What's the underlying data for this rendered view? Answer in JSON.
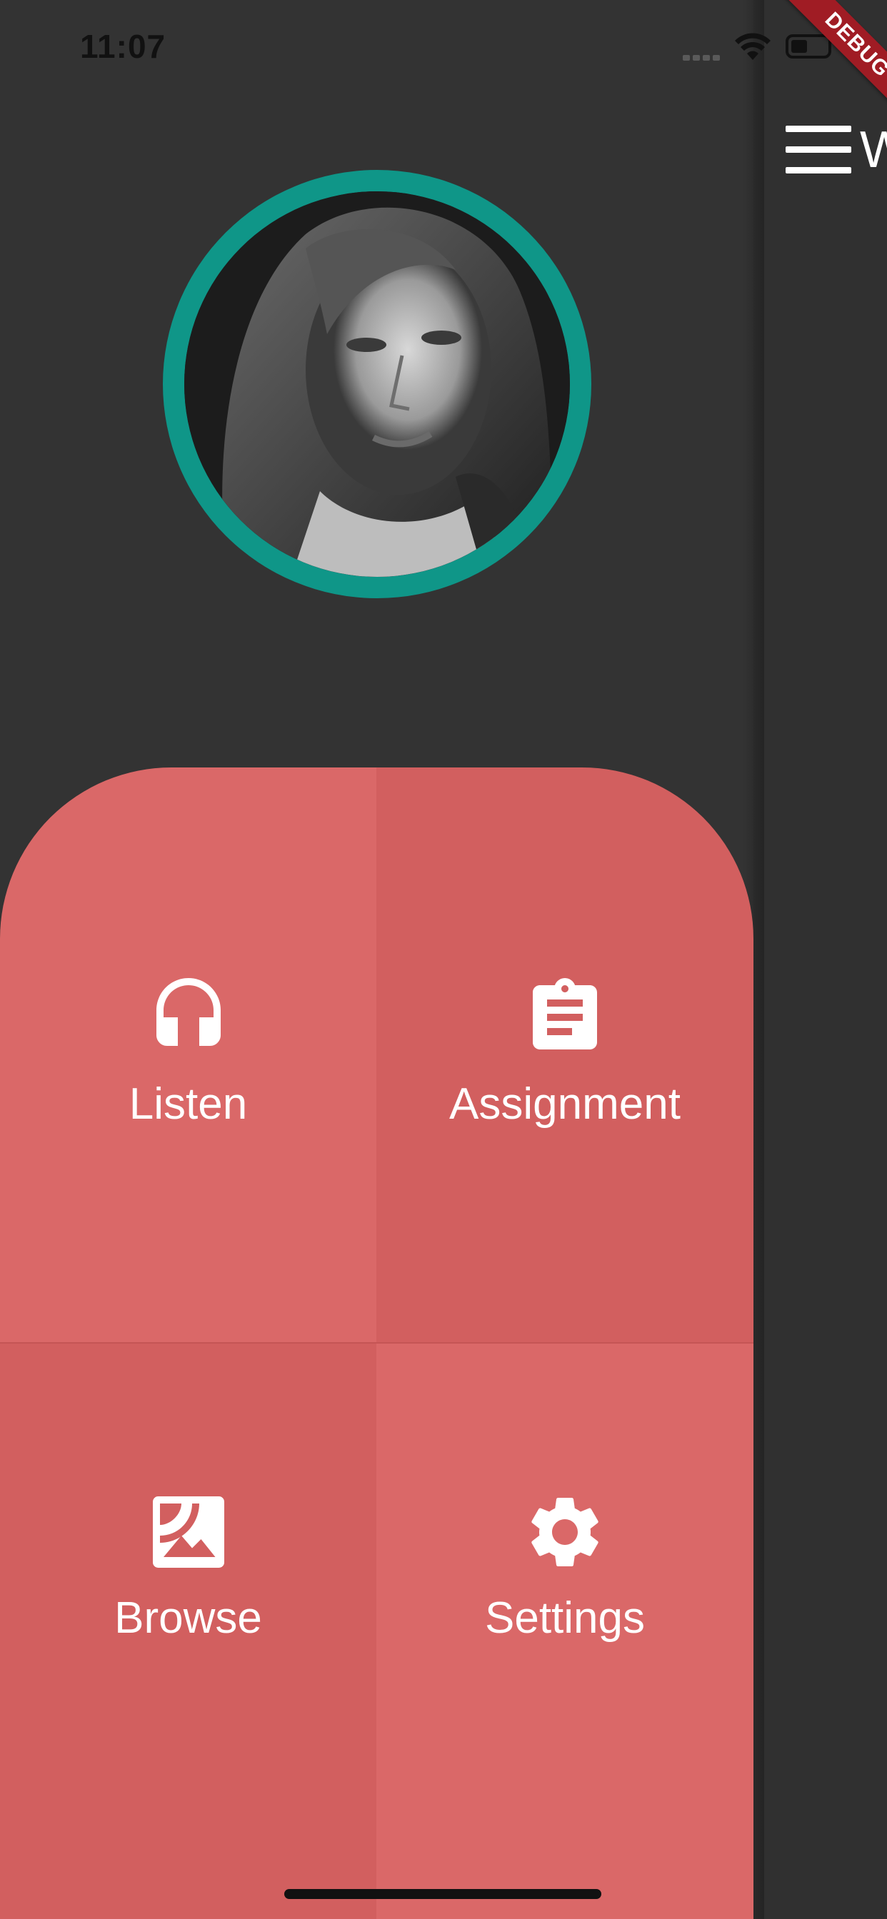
{
  "status_bar": {
    "time": "11:07"
  },
  "debug_banner": {
    "label": "DEBUG"
  },
  "main_page": {
    "title_peek": "W"
  },
  "drawer": {
    "menu": [
      {
        "label": "Listen",
        "icon": "headphones-icon"
      },
      {
        "label": "Assignment",
        "icon": "assignment-clipboard-icon"
      },
      {
        "label": "Browse",
        "icon": "image-icon"
      },
      {
        "label": "Settings",
        "icon": "gear-icon"
      }
    ]
  },
  "colors": {
    "background": "#333333",
    "avatar_ring": "#0f9688",
    "tile_light": "#da6868",
    "tile_dark": "#d25f5f",
    "debug_banner": "#a01c24"
  }
}
